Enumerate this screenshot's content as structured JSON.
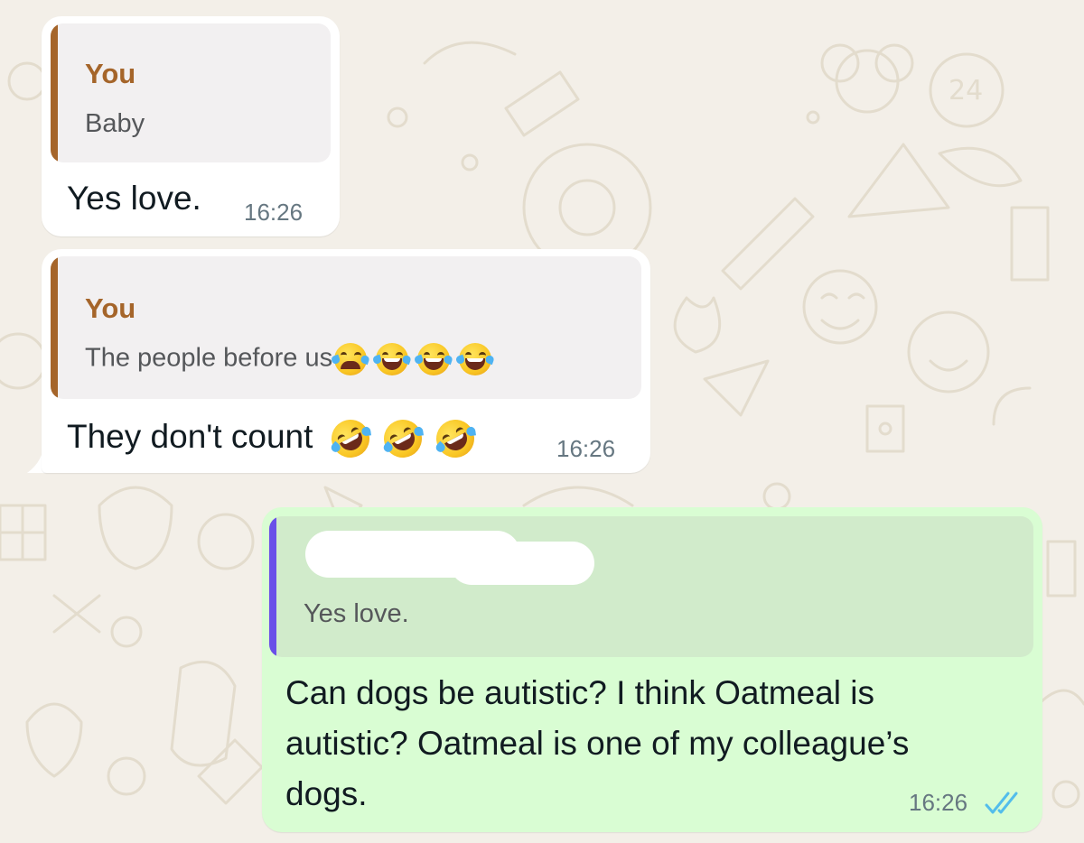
{
  "colors": {
    "background": "#f3efe8",
    "incoming_bubble": "#ffffff",
    "outgoing_bubble": "#d9fdd3",
    "quote_bar_you": "#a5652a",
    "quote_bar_other": "#6a4fe8",
    "author_name": "#a5652a",
    "read_ticks": "#53bdeb"
  },
  "messages": [
    {
      "direction": "incoming",
      "quote": {
        "author": "You",
        "text": "Baby",
        "emojis": []
      },
      "text": "Yes love.",
      "emojis": [],
      "time": "16:26"
    },
    {
      "direction": "incoming",
      "quote": {
        "author": "You",
        "text": "The people before us",
        "emojis": [
          "loudly-crying-face-emoji",
          "face-with-tears-of-joy-emoji",
          "face-with-tears-of-joy-emoji",
          "face-with-tears-of-joy-emoji"
        ]
      },
      "text": "They don't count",
      "emojis": [
        "rolling-on-the-floor-laughing-emoji",
        "rolling-on-the-floor-laughing-emoji",
        "rolling-on-the-floor-laughing-emoji"
      ],
      "time": "16:26"
    },
    {
      "direction": "outgoing",
      "quote": {
        "author_redacted": true,
        "text": "Yes love."
      },
      "text_lines": [
        "Can dogs be autistic? I think Oatmeal is",
        "autistic? Oatmeal is one of my colleague’s",
        "dogs."
      ],
      "time": "16:26",
      "status_icon": "double-check-read-icon"
    }
  ]
}
